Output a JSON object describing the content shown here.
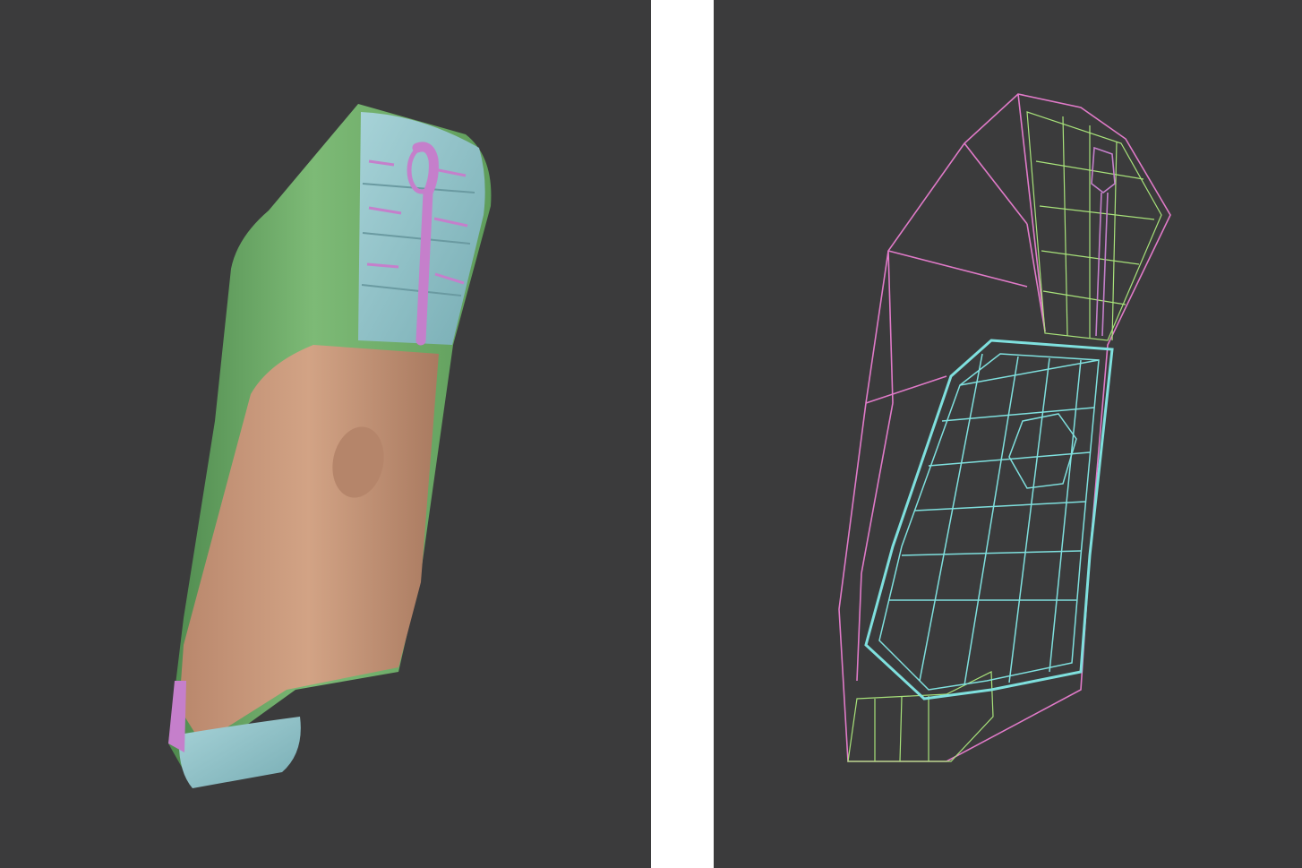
{
  "background": "#3b3b3c",
  "gutter_color": "#ffffff",
  "palette": {
    "green_shell": "#74b26f",
    "blue_face": "#8fc1c8",
    "purple_inset": "#c57fcb",
    "tan_grip": "#c4967a",
    "wire_pink": "#e07ac8",
    "wire_cyan": "#7fe0de",
    "wire_lime": "#a8e27a"
  },
  "panels": [
    {
      "name": "shaded-model",
      "kind": "polygroup-shaded"
    },
    {
      "name": "wireframe-model",
      "kind": "polygroup-wireframe"
    }
  ]
}
